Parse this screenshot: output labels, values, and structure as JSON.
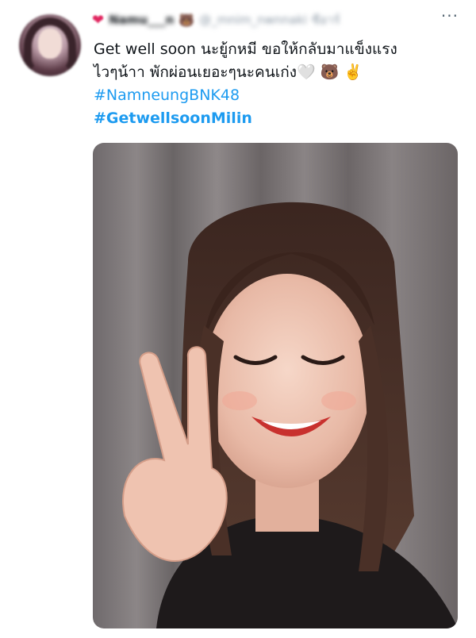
{
  "tweet": {
    "author_name": "Namu___n",
    "author_handle": "@_mnim_nwnnaki",
    "verified_text": "ซีอาร์",
    "header_icons": [
      "heart-icon",
      "bear-icon"
    ],
    "more_label": "···",
    "text_line_1": "Get well soon นะยู้กหมี ขอให้กลับมาแข็งแรง",
    "text_line_2": "ไวๆน้าา พักผ่อนเยอะๆนะคนเก่ง🤍 🐻 ✌️",
    "hashtag_1": "#NamneungBNK48",
    "hashtag_2": "#GetwellsoonMilin"
  },
  "colors": {
    "link": "#1d9bf0",
    "text": "#0f1419",
    "muted": "#536471",
    "heart": "#e0245e"
  }
}
